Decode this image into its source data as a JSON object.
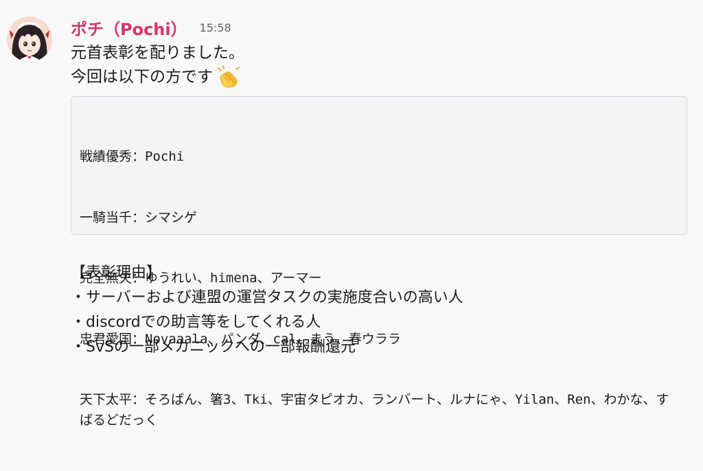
{
  "author": {
    "name": "ポチ（Pochi）",
    "time": "15:58"
  },
  "message": {
    "line1": "元首表彰を配りました。",
    "line2": "今回は以下の方です",
    "emoji": "clapping-hands-icon"
  },
  "code_block": {
    "lines": [
      "戦績優秀：Pochi",
      "一騎当千：シマシゲ",
      "完全無欠：ゆうれい、himena、アーマー",
      "忠君愛国：Novaaala、パンダ、cal、まう、春ウララ",
      "天下太平：そろばん、箸3、Tki、宇宙タピオカ、ランバート、ルナにゃ、Yilan、Ren、わかな、すばるどだっく"
    ]
  },
  "reasons": {
    "title": "【表彰理由】",
    "items": [
      "・サーバーおよび連盟の運営タスクの実施度合いの高い人",
      "・discordでの助言等をしてくれる人",
      "・SvSの一部メカニックへの一部報酬還元"
    ]
  },
  "colors": {
    "author": "#d6336c",
    "background": "#f8f8f8",
    "code_bg": "#f4f3f6",
    "code_border": "#d9d8dc"
  }
}
